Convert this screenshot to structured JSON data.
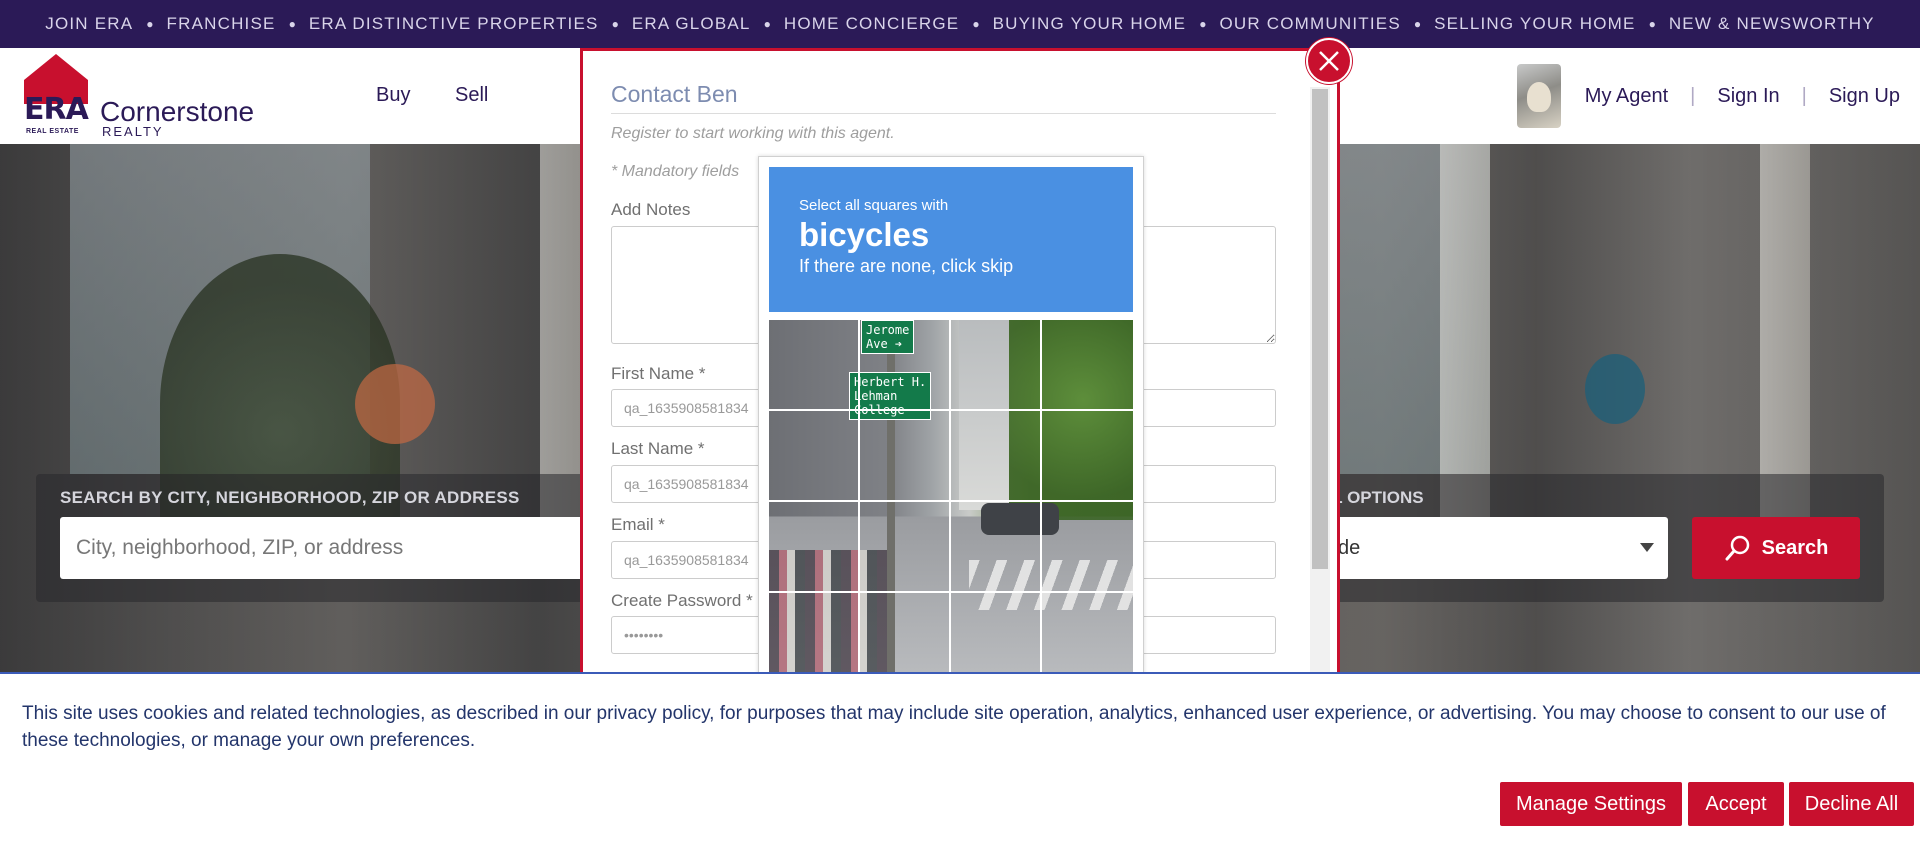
{
  "topbar": {
    "links": [
      "JOIN ERA",
      "FRANCHISE",
      "ERA DISTINCTIVE PROPERTIES",
      "ERA GLOBAL",
      "HOME CONCIERGE",
      "BUYING YOUR HOME",
      "OUR COMMUNITIES",
      "SELLING YOUR HOME",
      "NEW & NEWSWORTHY"
    ]
  },
  "header": {
    "logo": {
      "era": "ERA",
      "real_estate": "REAL ESTATE",
      "name": "Cornerstone",
      "sub": "REALTY"
    },
    "nav": {
      "buy": "Buy",
      "sell": "Sell"
    },
    "right": {
      "my_agent": "My Agent",
      "sign_in": "Sign In",
      "sign_up": "Sign Up",
      "sep": "|"
    }
  },
  "search": {
    "label": "SEARCH BY CITY, NEIGHBORHOOD, ZIP OR ADDRESS",
    "placeholder": "City, neighborhood, ZIP, or address",
    "additional_label": "AL OPTIONS",
    "select_value": "de",
    "button": "Search"
  },
  "modal": {
    "title": "Contact Ben",
    "subtitle": "Register to start working with this agent.",
    "mandatory": "* Mandatory fields",
    "notes_label": "Add Notes",
    "first_name_label": "First Name *",
    "first_name_value": "qa_1635908581834",
    "last_name_label": "Last Name *",
    "last_name_value": "qa_1635908581834",
    "email_label": "Email *",
    "email_value": "qa_1635908581834",
    "password_label": "Create Password *",
    "password_value": "••••••••"
  },
  "captcha": {
    "line1": "Select all squares with",
    "target": "bicycles",
    "line3": "If there are none, click skip",
    "sign1": "Jerome\nAve ➔",
    "sign2": "Herbert H.\nLehman\nCollege",
    "arrow": "➔"
  },
  "cookie": {
    "text": "This site uses cookies and related technologies, as described in our privacy policy, for purposes that may include site operation, analytics, enhanced user experience, or advertising. You may choose to consent to our use of these technologies, or manage your own preferences.",
    "manage": "Manage Settings",
    "accept": "Accept",
    "decline": "Decline All"
  },
  "colors": {
    "brand_purple": "#2b1a57",
    "brand_red": "#c8102e",
    "captcha_blue": "#4a90e2"
  }
}
